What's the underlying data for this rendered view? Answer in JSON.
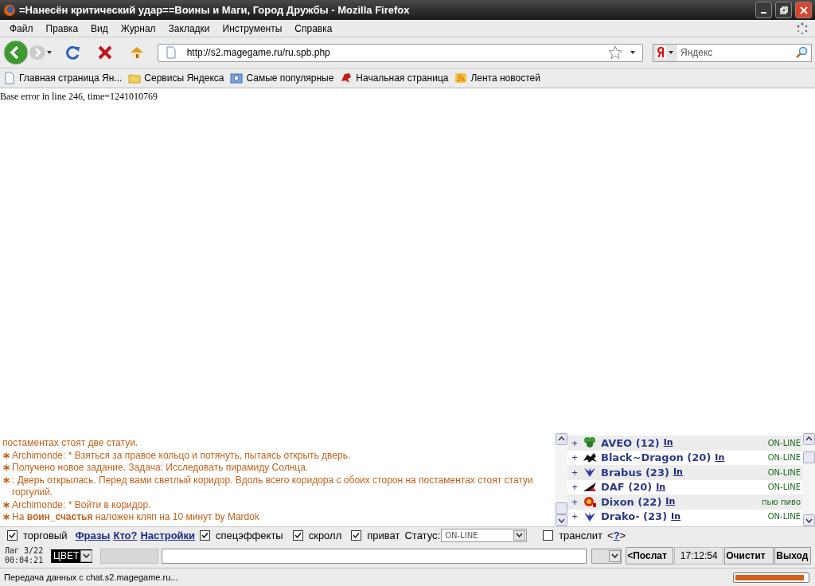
{
  "window": {
    "title": "=Нанесён критический удар==Воины и Маги, Город Дружбы - Mozilla Firefox"
  },
  "menu": [
    "Файл",
    "Правка",
    "Вид",
    "Журнал",
    "Закладки",
    "Инструменты",
    "Справка"
  ],
  "address": {
    "value": "http://s2.magegame.ru/ru.spb.php"
  },
  "search": {
    "placeholder": "Яндекс"
  },
  "bookmarks": [
    {
      "label": "Главная страница Ян...",
      "kind": "page"
    },
    {
      "label": "Сервисы Яндекса",
      "kind": "folder"
    },
    {
      "label": "Самые популярные",
      "kind": "smart"
    },
    {
      "label": "Начальная страница",
      "kind": "dragon"
    },
    {
      "label": "Лента новостей",
      "kind": "rss"
    }
  ],
  "page_text": "Base error in line 246, time=1241010769",
  "chat": [
    {
      "text": "постаментах стоят две статуи."
    },
    {
      "marker": "∗",
      "text": "Archimonde: * Взяться за правое кольцо и потянуть, пытаясь открыть дверь."
    },
    {
      "marker": "∗",
      "text": "Получено новое задание. Задача: Исследовать пирамиду Солнца."
    },
    {
      "marker": "∗",
      "text": ": Дверь открылась. Перед вами светлый коридор. Вдоль всего коридора с обоих сторон на постаментах стоят статуи горгулий."
    },
    {
      "marker": "∗",
      "text": "Archimonde: * Войти в коридор."
    },
    {
      "marker": "∗",
      "text": "На **воин_счастья** наложен кляп на 10 минут by Mardok"
    }
  ],
  "users": [
    {
      "expander": "+",
      "name": "AVEO (12)",
      "link": "In",
      "status": "ON-LINE",
      "kind": "clover"
    },
    {
      "expander": "+",
      "name": "Black~Dragon (20)",
      "link": "In",
      "status": "ON-LINE",
      "kind": "dragon"
    },
    {
      "expander": "+",
      "name": "Brabus (23)",
      "link": "In",
      "status": "ON-LINE",
      "kind": "wings"
    },
    {
      "expander": "+",
      "name": "DAF (20)",
      "link": "In",
      "status": "ON-LINE",
      "kind": "wedge"
    },
    {
      "expander": "+",
      "name": "Dixon (22)",
      "link": "In",
      "status": "пью пиво",
      "kind": "emblem"
    },
    {
      "expander": "+",
      "name": "Drako- (23)",
      "link": "In",
      "status": "ON-LINE",
      "kind": "wings"
    }
  ],
  "options": [
    {
      "kind": "checkbox",
      "label": "торговый",
      "checked": true
    },
    {
      "kind": "link",
      "label": "Фразы"
    },
    {
      "kind": "link",
      "label": "Кто?"
    },
    {
      "kind": "link",
      "label": "Настройки"
    },
    {
      "kind": "checkbox",
      "label": "спецэффекты",
      "checked": true
    },
    {
      "kind": "checkbox",
      "label": "скролл",
      "checked": true
    },
    {
      "kind": "checkbox",
      "label": "приват",
      "checked": true
    },
    {
      "kind": "label",
      "label": "Статус:"
    },
    {
      "kind": "select",
      "label": "ON-LINE"
    },
    {
      "kind": "checkbox",
      "label": "транслит",
      "checked": false
    },
    {
      "kind": "help",
      "label": "<",
      "link": "?",
      "after": ">"
    }
  ],
  "lag": {
    "line1": "Лаг 3/22",
    "line2": "00:04:21"
  },
  "color_select": "ЦВЕТ",
  "buttons": {
    "send": "<Послат",
    "time": "17:12:54",
    "clear": "Очистит",
    "exit": "Выход"
  },
  "status_bar": {
    "text": "Передача данных с chat.s2.magegame.ru...",
    "level": 0.95
  }
}
